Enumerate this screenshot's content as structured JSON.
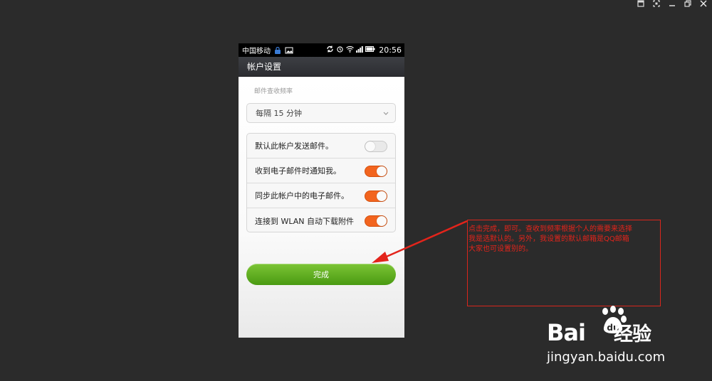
{
  "phone": {
    "status_bar": {
      "carrier": "中国移动",
      "time": "20:56"
    },
    "title": "帐户设置",
    "section_label": "邮件查收频率",
    "frequency_select": {
      "selected": "每隔 15 分钟"
    },
    "options": [
      {
        "label": "默认此帐户发送邮件。",
        "enabled": false
      },
      {
        "label": "收到电子邮件时通知我。",
        "enabled": true
      },
      {
        "label": "同步此帐户中的电子邮件。",
        "enabled": true
      },
      {
        "label": "连接到 WLAN 自动下载附件",
        "enabled": true
      }
    ],
    "done_button": "完成"
  },
  "annotation": {
    "lines": [
      "点击完成，即可。查收到频率根据个人的需要来选择",
      "我是选默认的。另外，我设置的默认邮箱是QQ邮箱",
      "大家也可设置别的。"
    ],
    "color": "#e3241b"
  },
  "watermark": {
    "logo": "Bai",
    "logo_suffix": "经验",
    "url": "jingyan.baidu.com"
  },
  "colors": {
    "toggle_on": "#f2641e",
    "done_button": "#5fae1f",
    "background": "#2b2b2b"
  }
}
